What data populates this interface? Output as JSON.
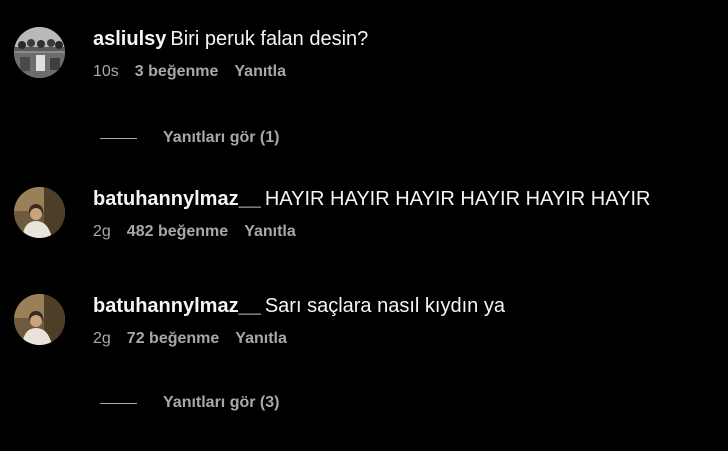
{
  "comments": [
    {
      "username": "asliulsy",
      "text": "Biri peruk falan desin?",
      "time": "10s",
      "likes": "3 beğenme",
      "reply_label": "Yanıtla",
      "view_replies": "Yanıtları gör (1)"
    },
    {
      "username": "batuhannylmaz__",
      "text": "HAYIR HAYIR HAYIR HAYIR HAYIR HAYIR",
      "time": "2g",
      "likes": "482 beğenme",
      "reply_label": "Yanıtla"
    },
    {
      "username": "batuhannylmaz__",
      "text": "Sarı saçlara nasıl kıydın ya",
      "time": "2g",
      "likes": "72 beğenme",
      "reply_label": "Yanıtla",
      "view_replies": "Yanıtları gör (3)"
    }
  ],
  "colors": {
    "background": "#000000",
    "primary_text": "#f5f5f5",
    "secondary_text": "#a8a8a8"
  },
  "icons": {
    "avatar_1": "group-photo-avatar",
    "avatar_2": "profile-photo-avatar",
    "avatar_3": "profile-photo-avatar"
  }
}
